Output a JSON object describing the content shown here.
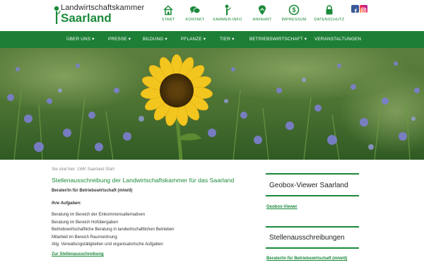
{
  "logo": {
    "line1": "Landwirtschaftskammer",
    "line2": "Saarland"
  },
  "topnav": [
    {
      "label": "START",
      "icon": "home-icon"
    },
    {
      "label": "KONTAKT",
      "icon": "chat-icon"
    },
    {
      "label": "KAMMER-INFO",
      "icon": "info-pin-icon"
    },
    {
      "label": "ANFAHRT",
      "icon": "map-pin-icon"
    },
    {
      "label": "IMPRESSUM",
      "icon": "dollar-circle-icon"
    },
    {
      "label": "DATENSCHUTZ",
      "icon": "lock-icon"
    }
  ],
  "social": {
    "facebook": "f"
  },
  "mainnav": [
    {
      "label": "ÜBER UNS ▾"
    },
    {
      "label": "PRESSE ▾"
    },
    {
      "label": "BILDUNG ▾"
    },
    {
      "label": "PFLANZE ▾"
    },
    {
      "label": "TIER ▾"
    },
    {
      "label": "BETRIEBSWIRTSCHAFT ▾"
    },
    {
      "label": "VERANSTALTUNGEN"
    }
  ],
  "breadcrumb": {
    "prefix": "Sie sind hier:",
    "current": "LWK Saarland Start"
  },
  "main": {
    "title": "Stellenausschreibung der Landwirtschaftskammer für das Saarland",
    "subtitle": "Berater/in für Betriebswirtschaft (m/w/d)",
    "tasks_heading": "Ihre Aufgaben:",
    "tasks": [
      "Beratung im Bereich der Einkommensalternativen",
      "Beratung im Bereich Hofübergaben",
      "Betriebswirtschaftliche Beratung in landwirtschaftlichen Betrieben",
      "Mitarbeit im Bereich Raumordnung",
      "Allg. Verwaltungstätigkeiten und organisatorische Aufgaben"
    ],
    "link_label": "Zur Stellenausschreibung"
  },
  "sidebar": {
    "geobox_title": "Geobox-Viewer Saarland",
    "geobox_link": "Geobox-Viewer",
    "jobs_title": "Stellenausschreibungen",
    "jobs_link": "Berater/in für Betriebswirtschaft (m/w/d)"
  },
  "colors": {
    "brand_green": "#1b8a3a",
    "nav_green": "#1d7f36"
  }
}
